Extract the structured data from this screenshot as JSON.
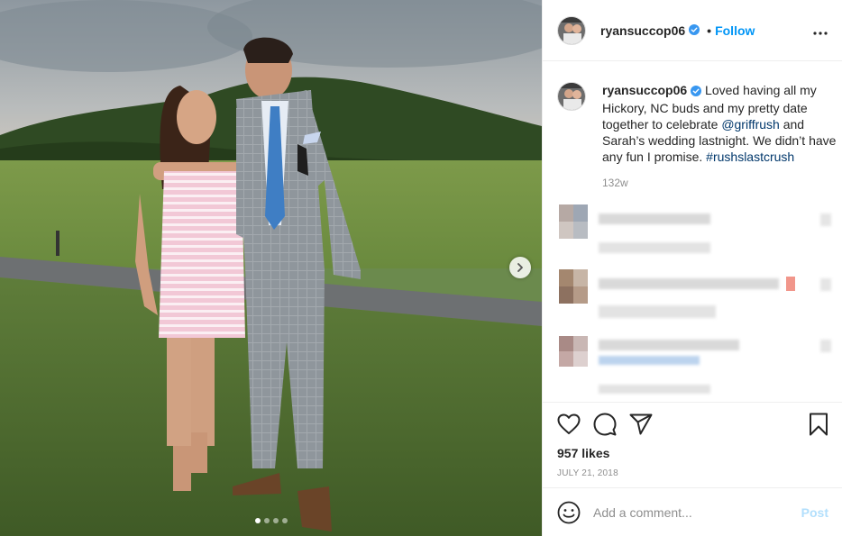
{
  "post": {
    "username": "ryansuccop06",
    "follow_label": "Follow",
    "separator": "•",
    "caption": {
      "username": "ryansuccop06",
      "text_part1": " Loved having all my Hickory, NC buds and my pretty date together to celebrate ",
      "mention": "@griffrush",
      "text_part2": " and Sarah’s wedding lastnight. We didn’t have any fun I promise. ",
      "hashtag": "#rushslastcrush",
      "time_ago": "132w"
    },
    "likes": "957 likes",
    "date": "JULY 21, 2018",
    "comment_input": {
      "placeholder": "Add a comment...",
      "value": ""
    },
    "post_label": "Post",
    "carousel": {
      "slides": 4,
      "current": 1
    }
  },
  "icons": {
    "verified": "verified-badge-icon",
    "more": "more-options-icon",
    "like": "heart-icon",
    "comment": "comment-bubble-icon",
    "share": "paper-plane-icon",
    "save": "bookmark-icon",
    "emoji": "smiley-icon",
    "next": "chevron-right-icon"
  },
  "colors": {
    "accent": "#0095f6",
    "link": "#00376b",
    "muted": "#8e8e8e",
    "post_disabled": "#b2dffc"
  }
}
